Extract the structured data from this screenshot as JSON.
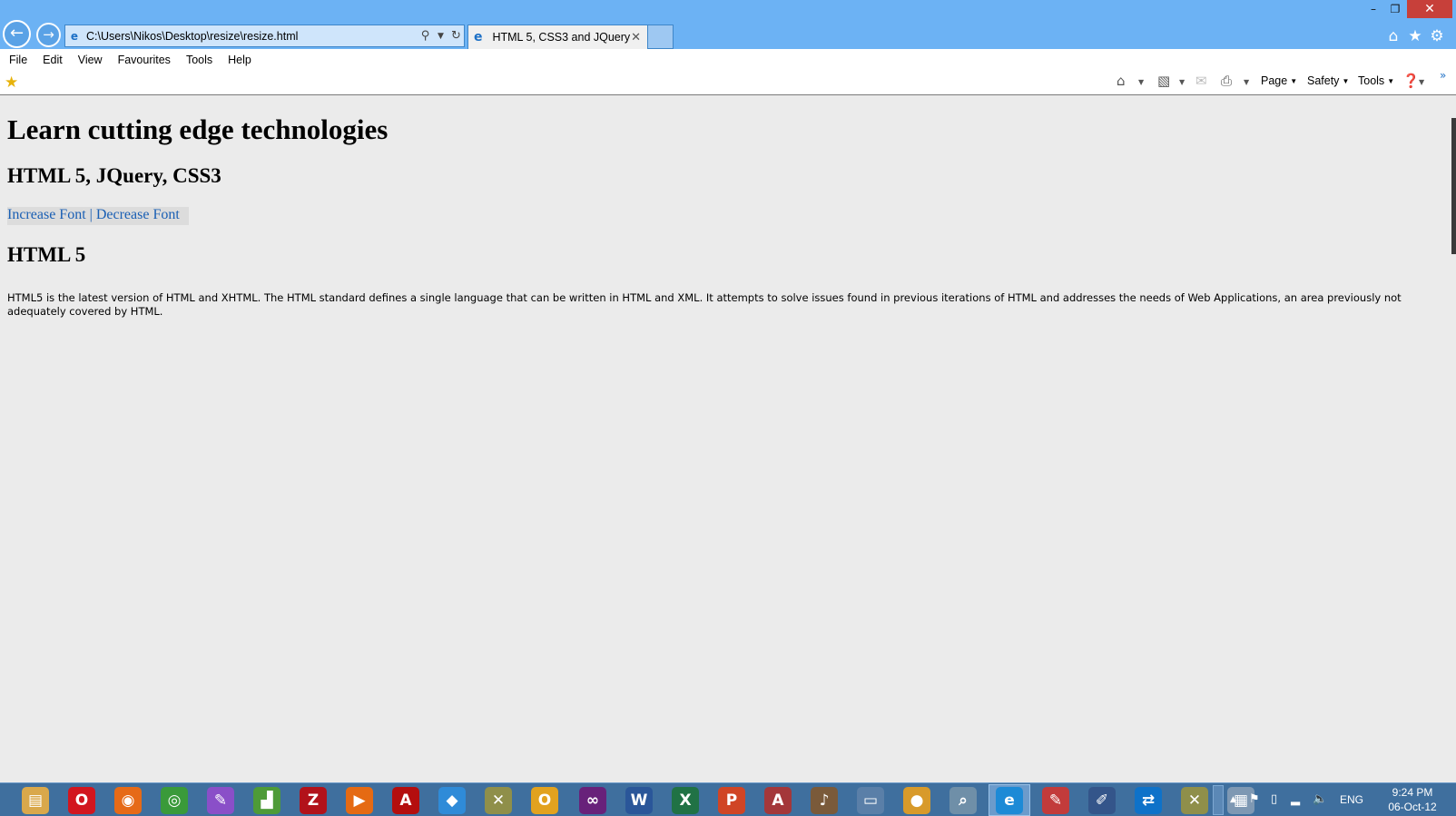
{
  "browser": {
    "address_url": "C:\\Users\\Nikos\\Desktop\\resize\\resize.html",
    "tab_title": "HTML 5, CSS3 and JQuery",
    "window_controls": {
      "minimize": "–",
      "restore": "❐",
      "close": "✕"
    }
  },
  "menu": {
    "items": [
      "File",
      "Edit",
      "View",
      "Favourites",
      "Tools",
      "Help"
    ]
  },
  "command_bar": {
    "page": "Page",
    "safety": "Safety",
    "tools": "Tools"
  },
  "page": {
    "title": "Learn cutting edge technologies",
    "subtitle": "HTML 5, JQuery, CSS3",
    "increase_font": "Increase Font",
    "separator": "|",
    "decrease_font": "Decrease Font",
    "section_heading": "HTML 5",
    "paragraph": "HTML5 is the latest version of HTML and XHTML. The HTML standard defines a single language that can be written in HTML and XML. It attempts to solve issues found in previous iterations of HTML and addresses the needs of Web Applications, an area previously not adequately covered by HTML."
  },
  "taskbar": {
    "apps": [
      {
        "icon": "file-explorer-icon",
        "color": "#d9a84b",
        "glyph": "▤"
      },
      {
        "icon": "opera-icon",
        "color": "#d2161f",
        "glyph": "O"
      },
      {
        "icon": "firefox-icon",
        "color": "#e66a17",
        "glyph": "◉"
      },
      {
        "icon": "chrome-icon",
        "color": "#3a9a3a",
        "glyph": "◎"
      },
      {
        "icon": "color-picker-icon",
        "color": "#8a4fc8",
        "glyph": "✎"
      },
      {
        "icon": "chart-app-icon",
        "color": "#4e9b38",
        "glyph": "▟"
      },
      {
        "icon": "filezilla-icon",
        "color": "#b2121a",
        "glyph": "Z"
      },
      {
        "icon": "media-player-icon",
        "color": "#e56a13",
        "glyph": "▶"
      },
      {
        "icon": "acrobat-icon",
        "color": "#b40e0e",
        "glyph": "A"
      },
      {
        "icon": "dropbox-icon",
        "color": "#2f8bd8",
        "glyph": "◆"
      },
      {
        "icon": "tools-icon",
        "color": "#8f8f4a",
        "glyph": "✕"
      },
      {
        "icon": "outlook-icon",
        "color": "#e2a21f",
        "glyph": "O"
      },
      {
        "icon": "visual-studio-icon",
        "color": "#68217a",
        "glyph": "∞"
      },
      {
        "icon": "word-icon",
        "color": "#2a5699",
        "glyph": "W"
      },
      {
        "icon": "excel-icon",
        "color": "#207245",
        "glyph": "X"
      },
      {
        "icon": "powerpoint-icon",
        "color": "#d04525",
        "glyph": "P"
      },
      {
        "icon": "access-icon",
        "color": "#a4373a",
        "glyph": "A"
      },
      {
        "icon": "music-app-icon",
        "color": "#7a5a3a",
        "glyph": "♪"
      },
      {
        "icon": "presentation-icon",
        "color": "#5a7fa8",
        "glyph": "▭"
      },
      {
        "icon": "paint-icon",
        "color": "#d89a2a",
        "glyph": "●"
      },
      {
        "icon": "magnifier-icon",
        "color": "#6f8fa8",
        "glyph": "⌕"
      },
      {
        "icon": "internet-explorer-icon",
        "color": "#1d8ad6",
        "glyph": "e",
        "active": true
      },
      {
        "icon": "pdf-tool-icon",
        "color": "#c23b3b",
        "glyph": "✎"
      },
      {
        "icon": "screen-tool-icon",
        "color": "#34558a",
        "glyph": "✐"
      },
      {
        "icon": "teamviewer-icon",
        "color": "#0e72c9",
        "glyph": "⇄"
      },
      {
        "icon": "settings-tools-icon",
        "color": "#8f8f4a",
        "glyph": "✕"
      },
      {
        "icon": "virtual-box-icon",
        "color": "#7e98b3",
        "glyph": "▦"
      }
    ],
    "language": "ENG",
    "time": "9:24 PM",
    "date": "06-Oct-12"
  }
}
